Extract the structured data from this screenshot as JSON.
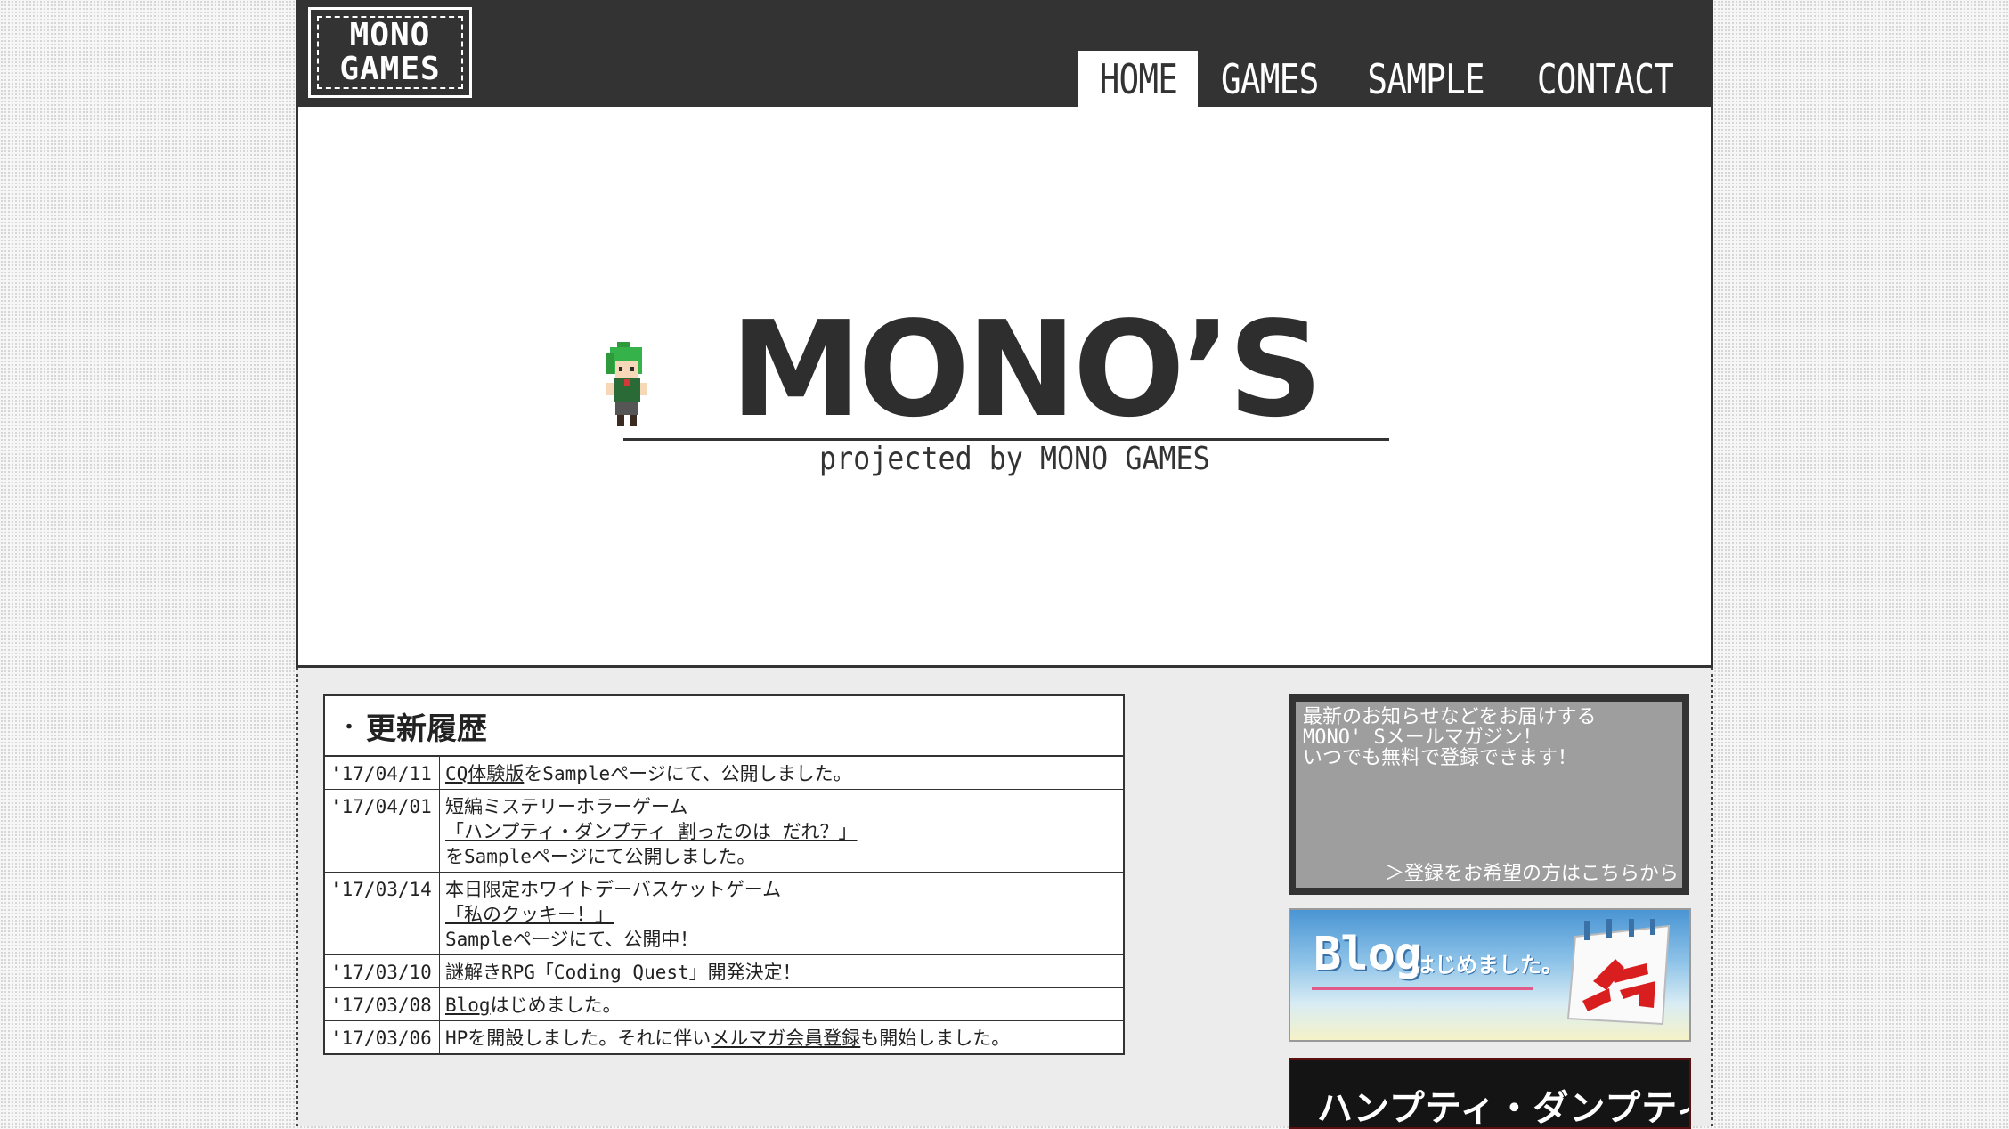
{
  "header": {
    "logo_line1": "MONO",
    "logo_line2": "GAMES",
    "nav": [
      {
        "label": "HOME",
        "active": true
      },
      {
        "label": "GAMES",
        "active": false
      },
      {
        "label": "SAMPLE",
        "active": false
      },
      {
        "label": "CONTACT",
        "active": false
      }
    ]
  },
  "hero": {
    "title": "MONO’S",
    "subtitle": "projected by MONO GAMES"
  },
  "news": {
    "title": "更新履歴",
    "bullet": "・",
    "items": [
      {
        "date": "'17/04/11",
        "link": "CQ体験版",
        "text": "をSampleページにて、公開しました。"
      },
      {
        "date": "'17/04/01",
        "line1": "短編ミステリーホラーゲーム",
        "link": "「ハンプティ・ダンプティ 割ったのは だれ？」",
        "line3": "をSampleページにて公開しました。"
      },
      {
        "date": "'17/03/14",
        "line1": "本日限定ホワイトデーバスケットゲーム",
        "link": "「私のクッキー！」",
        "line3": "Sampleページにて、公開中！"
      },
      {
        "date": "'17/03/10",
        "text": "謎解きRPG「Coding Quest」開発決定！"
      },
      {
        "date": "'17/03/08",
        "link": "Blog",
        "text": "はじめました。"
      },
      {
        "date": "'17/03/06",
        "prefix": "HPを開設しました。それに伴い",
        "link": "メルマガ会員登録",
        "suffix": "も開始しました。"
      }
    ]
  },
  "sidebar": {
    "mail": {
      "line1": "最新のお知らせなどをお届けする",
      "line2": "MONO' Sメールマガジン！",
      "line3": "いつでも無料で登録できます！",
      "link": "＞登録をお希望の方はこちらから"
    },
    "blog": {
      "word": "Blog",
      "sub": "はじめました。"
    },
    "humpty": {
      "text": "ハンプティ・ダンプティ"
    }
  }
}
